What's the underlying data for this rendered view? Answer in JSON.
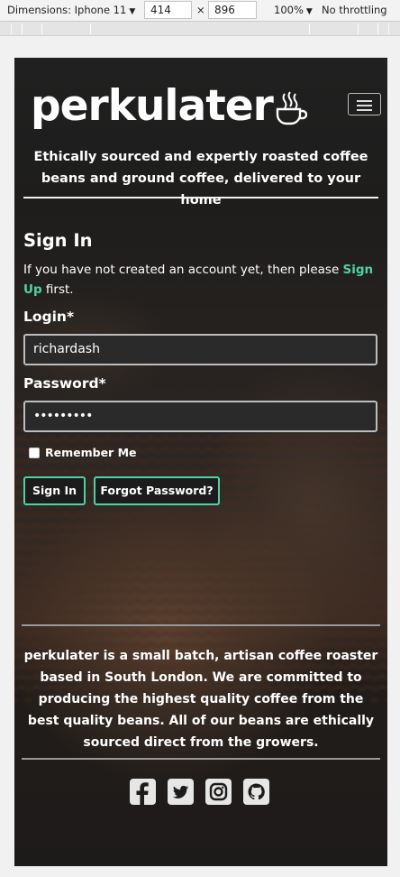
{
  "devtools": {
    "device_label": "Dimensions: Iphone 11",
    "width": "414",
    "times": "×",
    "height": "896",
    "zoom": "100%",
    "throttle": "No throttling"
  },
  "site": {
    "logo": "perkulater",
    "tagline": "Ethically sourced and expertly roasted coffee beans and ground coffee, delivered to your home",
    "menu_icon": "hamburger-icon"
  },
  "signin": {
    "title": "Sign In",
    "note_prefix": "If you have not created an account yet, then please ",
    "note_link": "Sign Up",
    "note_suffix": " first.",
    "login_label": "Login*",
    "login_value": "richardash",
    "password_label": "Password*",
    "password_value": "•••••••••",
    "remember_label": "Remember Me",
    "signin_button": "Sign In",
    "forgot_button": "Forgot Password?"
  },
  "footer": {
    "about": "perkulater is a small batch, artisan coffee roaster based in South London. We are committed to producing the highest quality coffee from the best quality beans. All of our beans are ethically sourced direct from the growers.",
    "social_icons": [
      "facebook-icon",
      "twitter-icon",
      "instagram-icon",
      "github-icon"
    ]
  },
  "colors": {
    "accent": "#4fd1a5",
    "background": "#1e1d1c",
    "text": "#ffffff"
  }
}
